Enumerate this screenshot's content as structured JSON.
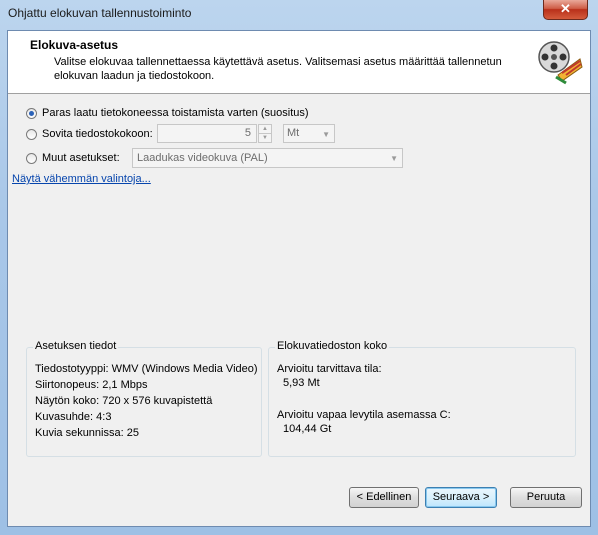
{
  "window": {
    "title": "Ohjattu elokuvan tallennustoiminto",
    "close_glyph": "✕"
  },
  "header": {
    "title": "Elokuva-asetus",
    "description": "Valitse elokuvaa tallennettaessa käytettävä asetus. Valitsemasi asetus määrittää tallennetun elokuvan laadun ja tiedostokoon."
  },
  "options": {
    "best_quality": {
      "label": "Paras laatu tietokoneessa toistamista varten (suositus)",
      "selected": true
    },
    "fit_size": {
      "label": "Sovita tiedostokokoon:",
      "value": "5",
      "unit": "Mt",
      "selected": false
    },
    "other": {
      "label": "Muut asetukset:",
      "value": "Laadukas videokuva (PAL)",
      "selected": false
    }
  },
  "link": "Näytä vähemmän valintoja...",
  "settings_info": {
    "title": "Asetuksen tiedot",
    "lines": [
      "Tiedostotyyppi: WMV (Windows Media Video)",
      "Siirtonopeus: 2,1 Mbps",
      "Näytön koko: 720 x 576 kuvapistettä",
      "Kuvasuhde: 4:3",
      "Kuvia sekunnissa: 25"
    ]
  },
  "file_size": {
    "title": "Elokuvatiedoston koko",
    "required_label": "Arvioitu tarvittava tila:",
    "required_value": "5,93 Mt",
    "free_label": "Arvioitu vapaa levytila asemassa C:",
    "free_value": "104,44 Gt"
  },
  "buttons": {
    "back": "< Edellinen",
    "next": "Seuraava >",
    "cancel": "Peruuta"
  },
  "icons": {
    "film": "film-reel-icon",
    "up": "▲",
    "down": "▼",
    "dropdown": "▼"
  }
}
